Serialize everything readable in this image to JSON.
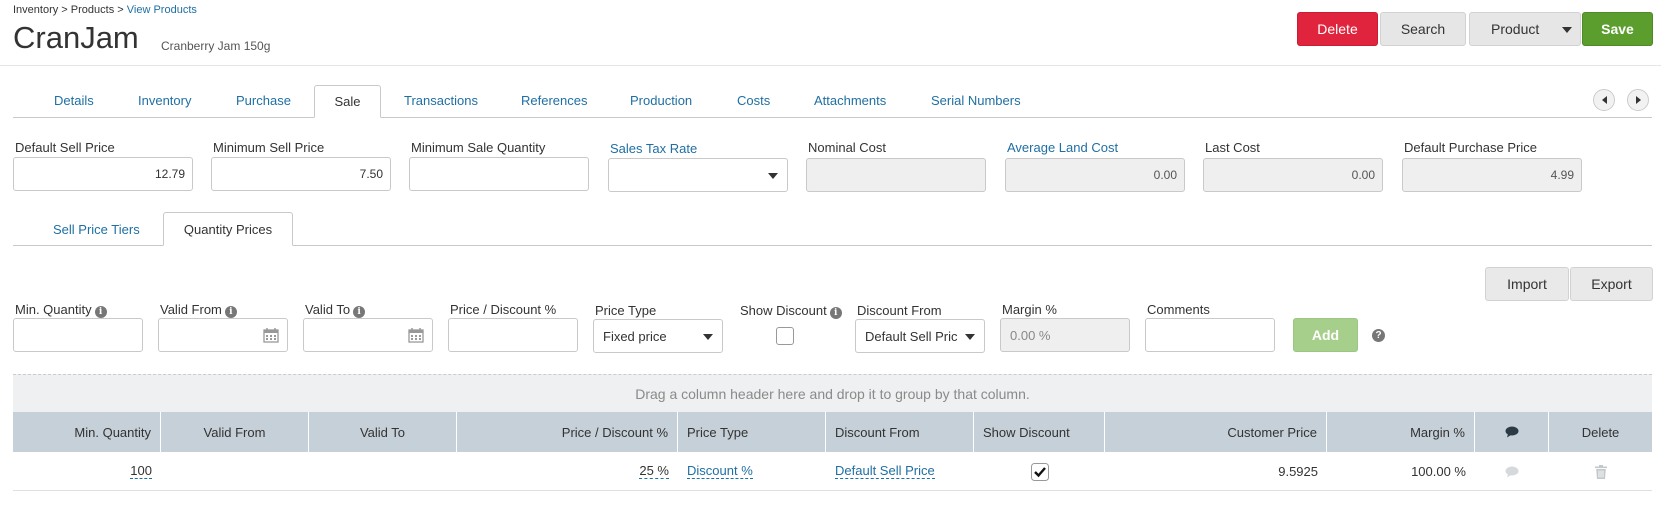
{
  "header": {
    "breadcrumb": {
      "item1": "Inventory",
      "sep": " > ",
      "item2": "Products",
      "current": "View Products"
    },
    "title": "CranJam",
    "subtitle": "Cranberry Jam 150g",
    "buttons": {
      "delete": "Delete",
      "search": "Search",
      "product": "Product",
      "save": "Save"
    }
  },
  "tabs": {
    "items": [
      "Details",
      "Inventory",
      "Purchase",
      "Sale",
      "Transactions",
      "References",
      "Production",
      "Costs",
      "Attachments",
      "Serial Numbers"
    ],
    "active": "Sale"
  },
  "price_fields": {
    "default_sell_price": {
      "label": "Default Sell Price",
      "value": "12.79"
    },
    "minimum_sell_price": {
      "label": "Minimum Sell Price",
      "value": "7.50"
    },
    "minimum_sale_quantity": {
      "label": "Minimum Sale Quantity",
      "value": ""
    },
    "sales_tax_rate": {
      "label": "Sales Tax Rate",
      "value": ""
    },
    "nominal_cost": {
      "label": "Nominal Cost",
      "value": ""
    },
    "average_land_cost": {
      "label": "Average Land Cost",
      "value": "0.00"
    },
    "last_cost": {
      "label": "Last Cost",
      "value": "0.00"
    },
    "default_purchase_price": {
      "label": "Default Purchase Price",
      "value": "4.99"
    }
  },
  "subtabs": {
    "items": [
      "Sell Price Tiers",
      "Quantity Prices"
    ],
    "active": "Quantity Prices"
  },
  "actions": {
    "import": "Import",
    "export": "Export"
  },
  "entry_form": {
    "min_quantity": {
      "label": "Min. Quantity",
      "value": ""
    },
    "valid_from": {
      "label": "Valid From",
      "value": ""
    },
    "valid_to": {
      "label": "Valid To",
      "value": ""
    },
    "price_discount": {
      "label": "Price / Discount %",
      "value": ""
    },
    "price_type": {
      "label": "Price Type",
      "value": "Fixed price"
    },
    "show_discount": {
      "label": "Show Discount",
      "checked": false
    },
    "discount_from": {
      "label": "Discount From",
      "value": "Default Sell Pric"
    },
    "margin": {
      "label": "Margin %",
      "placeholder": "0.00 %"
    },
    "comments": {
      "label": "Comments",
      "value": ""
    },
    "add_label": "Add",
    "help_glyph": "?",
    "info_glyph": "i"
  },
  "grid": {
    "group_hint": "Drag a column header here and drop it to group by that column.",
    "columns": [
      "Min. Quantity",
      "Valid From",
      "Valid To",
      "Price / Discount %",
      "Price Type",
      "Discount From",
      "Show Discount",
      "Customer Price",
      "Margin %",
      "comments-icon",
      "Delete"
    ],
    "rows": [
      {
        "min_quantity": "100",
        "valid_from": "",
        "valid_to": "",
        "price_discount": "25 %",
        "price_type": "Discount %",
        "discount_from": "Default Sell Price",
        "show_discount": true,
        "customer_price": "9.5925",
        "margin": "100.00 %"
      }
    ]
  },
  "colors": {
    "link": "#1f6fa3",
    "delete": "#e0243d",
    "save": "#5b9e2d",
    "add_disabled": "#a6cf8c",
    "grid_header": "#c6d0d8"
  }
}
